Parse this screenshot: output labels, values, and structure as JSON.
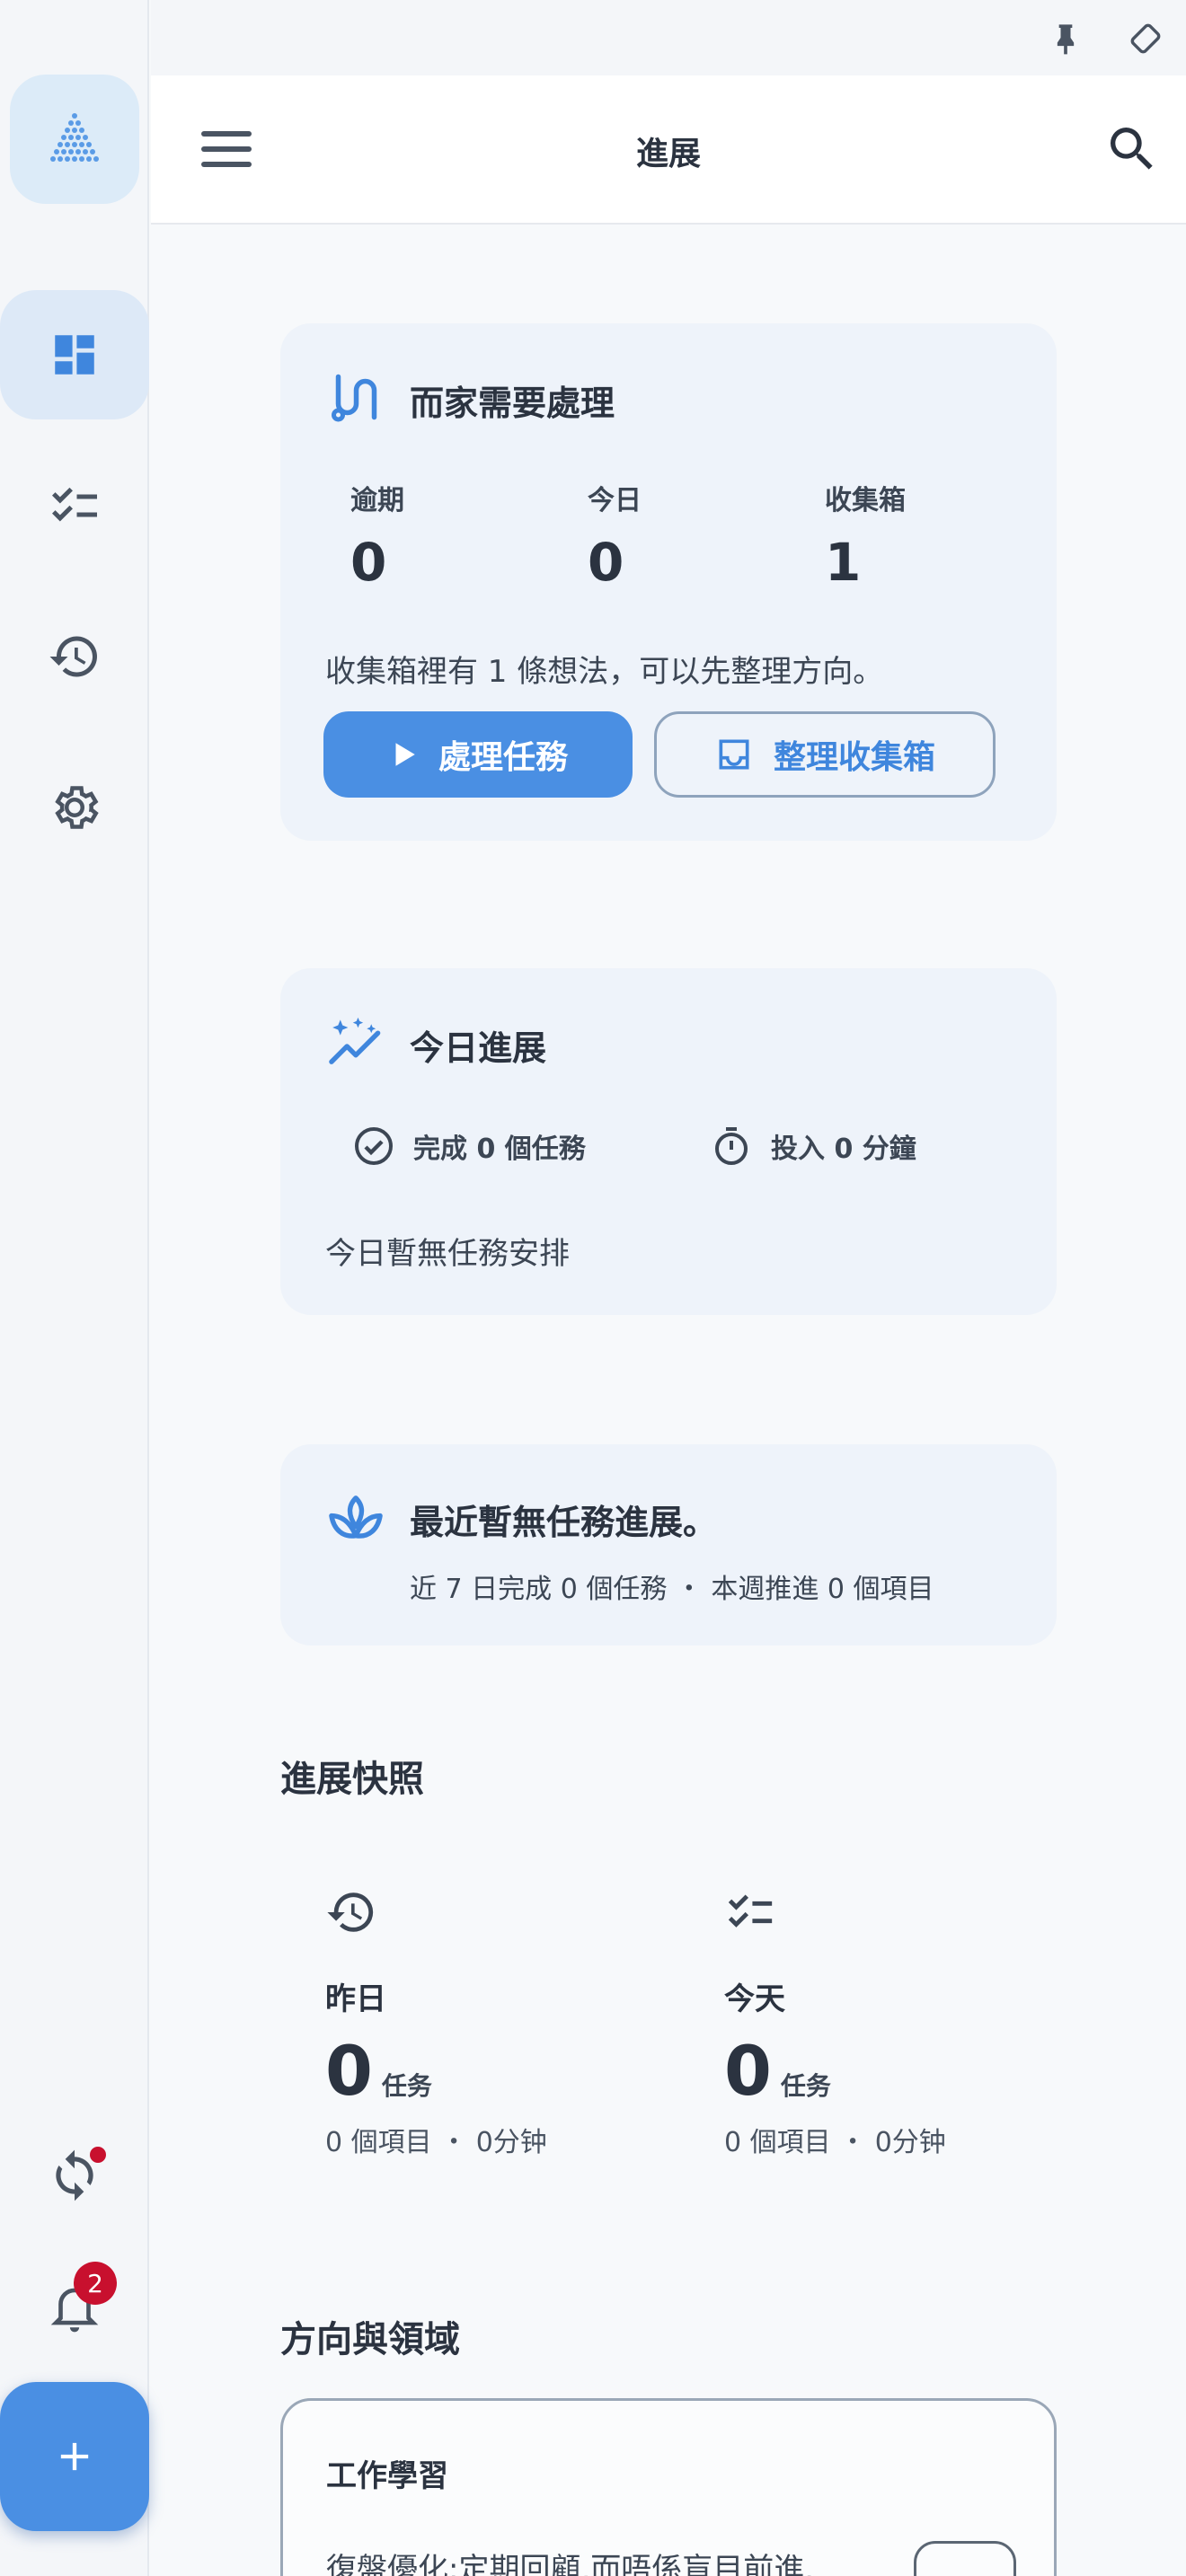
{
  "app": {
    "title": "進展"
  },
  "inbox_card": {
    "title": "而家需要處理",
    "stats": [
      {
        "label": "逾期",
        "value": "0"
      },
      {
        "label": "今日",
        "value": "0"
      },
      {
        "label": "收集箱",
        "value": "1"
      }
    ],
    "message": "收集箱裡有 1 條想法，可以先整理方向。",
    "primary_button": "處理任務",
    "secondary_button": "整理收集箱"
  },
  "today_card": {
    "title": "今日進展",
    "completed": "完成 0 個任務",
    "invested": "投入 0 分鐘",
    "empty": "今日暫無任務安排"
  },
  "recent_card": {
    "title": "最近暫無任務進展。",
    "subtitle": "近 7 日完成 0 個任務 ・ 本週推進 0 個項目"
  },
  "snapshot": {
    "title": "進展快照",
    "items": [
      {
        "label": "昨日",
        "value": "0",
        "unit": "任务",
        "meta": "0 個項目 ・ 0分钟"
      },
      {
        "label": "今天",
        "value": "0",
        "unit": "任务",
        "meta": "0 個項目 ・ 0分钟"
      }
    ]
  },
  "domains": {
    "title": "方向與領域",
    "items": [
      {
        "name": "工作學習",
        "desc": "復盤優化:定期回顧,而唔係盲目前進."
      }
    ]
  },
  "sidebar": {
    "notification_count": "2"
  },
  "colors": {
    "accent": "#4a8fe3",
    "card_bg": "#eef3fa",
    "badge": "#c8102e"
  }
}
